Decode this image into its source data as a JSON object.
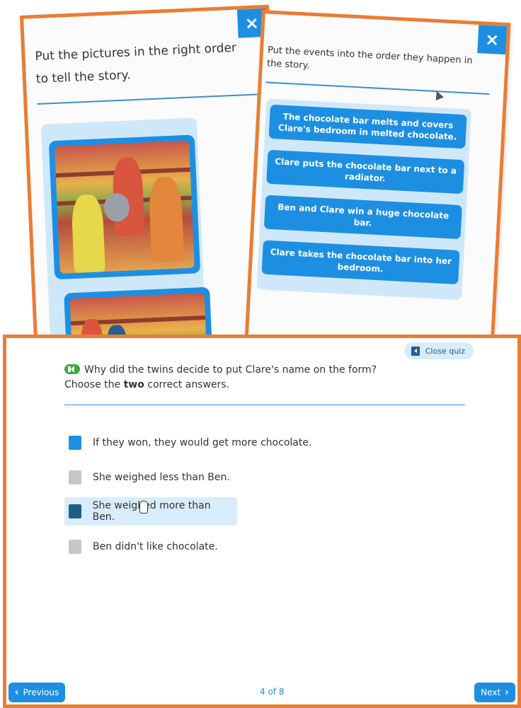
{
  "card_left": {
    "prompt": "Put the pictures in the right order to tell the story.",
    "close_icon": "×"
  },
  "card_right": {
    "prompt": "Put the events into the order they happen in the story.",
    "close_icon": "×",
    "events": [
      "The chocolate bar melts and covers Clare's bedroom in melted chocolate.",
      "Clare puts the chocolate bar next to a radiator.",
      "Ben and Clare win a huge chocolate bar.",
      "Clare takes the chocolate bar into her bedroom."
    ]
  },
  "quiz": {
    "close_label": "Close quiz",
    "question": "Why did the twins decide to put Clare's name on the form?",
    "instruction_prefix": "Choose the ",
    "instruction_bold": "two",
    "instruction_suffix": " correct answers.",
    "options": [
      {
        "label": "If they won, they would get more chocolate.",
        "state": "selected"
      },
      {
        "label": "She weighed less than Ben.",
        "state": "unselected"
      },
      {
        "label": "She weighed more than Ben.",
        "state": "hover"
      },
      {
        "label": "Ben didn't like chocolate.",
        "state": "unselected"
      }
    ],
    "previous_label": "Previous",
    "next_label": "Next",
    "page_indicator": "4 of 8",
    "colors": {
      "accent": "#1d8fe3",
      "frame": "#ea7d33",
      "hover": "#d8ecfb"
    }
  }
}
